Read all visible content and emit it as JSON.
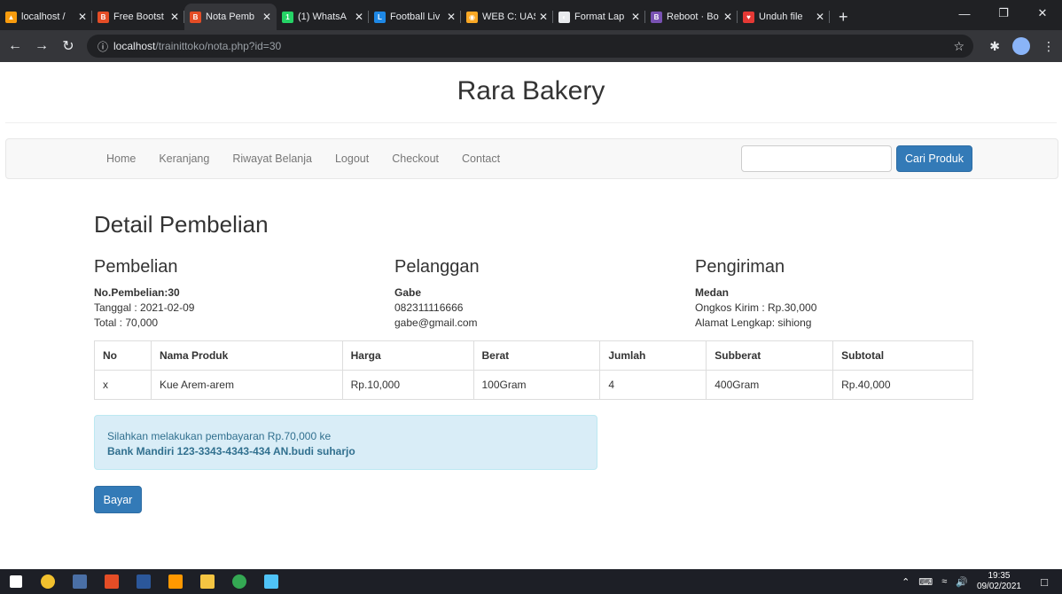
{
  "browser": {
    "tabs": [
      {
        "title": "localhost /",
        "color": "#f89c0e",
        "glyph": "▲"
      },
      {
        "title": "Free Bootst",
        "color": "#e44d26",
        "glyph": "B"
      },
      {
        "title": "Nota Pemb",
        "color": "#e44d26",
        "glyph": "B",
        "active": true
      },
      {
        "title": "(1) WhatsA",
        "color": "#25d366",
        "glyph": "1"
      },
      {
        "title": "Football Liv",
        "color": "#1e88e5",
        "glyph": "L"
      },
      {
        "title": "WEB C: UAS",
        "color": "#f9a825",
        "glyph": "◉"
      },
      {
        "title": "Format Lap",
        "color": "#e8eaed",
        "glyph": "◐"
      },
      {
        "title": "Reboot · Bo",
        "color": "#7952b3",
        "glyph": "B"
      },
      {
        "title": "Unduh file",
        "color": "#e53935",
        "glyph": "♥"
      }
    ],
    "new_tab": "+",
    "url_host": "localhost",
    "url_path": "/trainittoko/nota.php?id=30"
  },
  "site": {
    "brand": "Rara Bakery",
    "nav": [
      "Home",
      "Keranjang",
      "Riwayat Belanja",
      "Logout",
      "Checkout",
      "Contact"
    ],
    "search_placeholder": "",
    "search_button": "Cari Produk"
  },
  "detail": {
    "heading": "Detail Pembelian",
    "pembelian": {
      "title": "Pembelian",
      "no": "No.Pembelian:30",
      "tanggal": "Tanggal : 2021-02-09",
      "total": "Total : 70,000"
    },
    "pelanggan": {
      "title": "Pelanggan",
      "nama": "Gabe",
      "telepon": "082311116666",
      "email": "gabe@gmail.com"
    },
    "pengiriman": {
      "title": "Pengiriman",
      "kota": "Medan",
      "ongkos": "Ongkos Kirim : Rp.30,000",
      "alamat": "Alamat Lengkap: sihiong"
    },
    "table": {
      "headers": [
        "No",
        "Nama Produk",
        "Harga",
        "Berat",
        "Jumlah",
        "Subberat",
        "Subtotal"
      ],
      "rows": [
        [
          "x",
          "Kue Arem-arem",
          "Rp.10,000",
          "100Gram",
          "4",
          "400Gram",
          "Rp.40,000"
        ]
      ]
    },
    "alert_line1": "Silahkan melakukan pembayaran Rp.70,000 ke",
    "alert_line2": "Bank Mandiri 123-3343-4343-434 AN.budi suharjo",
    "pay_button": "Bayar"
  },
  "taskbar": {
    "time": "19:35",
    "date": "09/02/2021"
  }
}
